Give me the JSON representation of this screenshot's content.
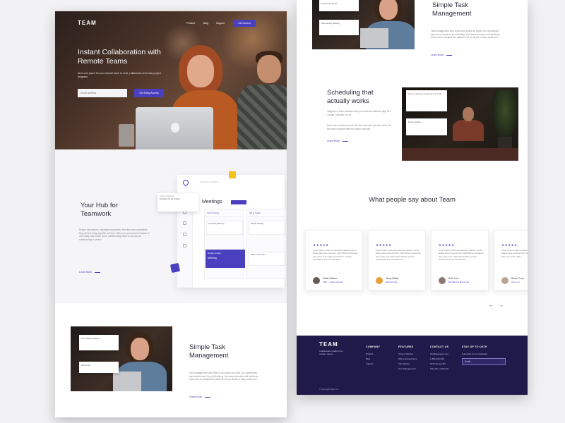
{
  "brand": "TEAM",
  "nav": {
    "product": "Product",
    "blog": "Blog",
    "support": "Support",
    "access": "Get Access"
  },
  "hero": {
    "title": "Instant Collaboration with Remote Teams",
    "subtitle": "All-in-one place for your remote team to chat, collaborate and track project progress.",
    "email_placeholder": "Email address",
    "cta": "Get Early Access"
  },
  "hub": {
    "title": "Your Hub for Teamwork",
    "text": "Project discussions, important documents, free time announcements. Stay all tied neatly together at Team. With your work and information in one easily searchable place, collaborating online is as easy as collaborating in person.",
    "learn_more": "Learn More",
    "mock": {
      "title": "Meetings",
      "search_placeholder": "Search for anything...",
      "col1": "Q2 in Priority",
      "col2": "Q3 in Today",
      "card1": "Important gathering",
      "card2": "Weekly backlog",
      "card3": "Write a new ticket",
      "float_label": "Sales & Marketing",
      "float_text": "Feedback for the Product",
      "purple_label": "Design review",
      "purple_text": "Meeting"
    }
  },
  "task_left": {
    "title": "Simple Task Management",
    "text": "Task management with Team is as simple as it gets. No complicated layout and crowd for your thinking. Your team members will intuitively know how to navigate the platform. It's so simple, a baby could do it.",
    "learn_more": "Learn More",
    "card1": "Give weekly backlog",
    "card2": "Write brief"
  },
  "task_right": {
    "title": "Simple Task Management",
    "text": "Task management with Team is as simple as it gets. No complicated layout and crowd for your thinking. Your team members will intuitively know how to navigate the platform. It's so simple, a baby could do it.",
    "learn_more": "Learn More",
    "card1": "Review the layout",
    "card2": "Give weekly backlog"
  },
  "schedule": {
    "title": "Scheduling that actually works",
    "text1": "Integrate a Team calendar with your favourite calendar app, be it Google Calendar or iCal.",
    "text2": "Each team member sends with their favourite calendar while all the data is synced with the master calendar.",
    "learn_more": "Learn More",
    "card1": "Are you guys we need to go our 3 call",
    "card2": "Team meeting"
  },
  "testimonials": {
    "title": "What people say about Team",
    "items": [
      {
        "stars": "★★★★★",
        "quote": "Amet minim mollit non deserunt ullamco est sit aliqua dolor do amet sint. Velit officia consequat duis enim velit mollit. Exercitation veniam consequat sunt nostrud amet.",
        "name": "Kristin Watson",
        "role": "CEO — Alpha Century"
      },
      {
        "stars": "★★★★★",
        "quote": "Amet minim mollit non deserunt ullamco est sit aliqua dolor do amet sint. Velit officia consequat duis enim velit mollit. Exercitation veniam consequat sunt nostrud amet.",
        "name": "Jenny Wilson",
        "role": "Webflow Ltd."
      },
      {
        "stars": "★★★★★",
        "quote": "Amet minim mollit non deserunt ullamco est sit aliqua dolor do amet sint. Velit officia consequat duis enim velit mollit. Exercitation veniam consequat sunt nostrud amet.",
        "name": "Ruth Love",
        "role": "Big Kahuna Burger Ltd."
      },
      {
        "stars": "★★★★★",
        "quote": "Amet minim mollit non deserunt ullamco est sit aliqua dolor do amet sint. Velit officia consequat duis enim velit mollit.",
        "name": "Resco Coop",
        "role": "Acme Co."
      }
    ],
    "prev": "←",
    "next": "→"
  },
  "footer": {
    "logo": "TEAM",
    "tagline": "Collaboration platform for modern teams.",
    "company": {
      "title": "COMPANY",
      "items": [
        "Product",
        "Blog",
        "Support"
      ]
    },
    "features": {
      "title": "FEATURES",
      "items": [
        "Screen Sharing",
        "iOS & Android Apps",
        "File Sharing",
        "User Management"
      ]
    },
    "contact": {
      "title": "CONTACT US",
      "items": [
        "info@teamapp.com",
        "1-800-200-300",
        "1010 Sunset Blv.",
        "Palo Alto, California"
      ]
    },
    "stay": {
      "title": "STAY UP TO DATE",
      "text": "Subscribe to our newsletter",
      "placeholder": "Email"
    },
    "copyright": "© Copyright Team Inc."
  }
}
